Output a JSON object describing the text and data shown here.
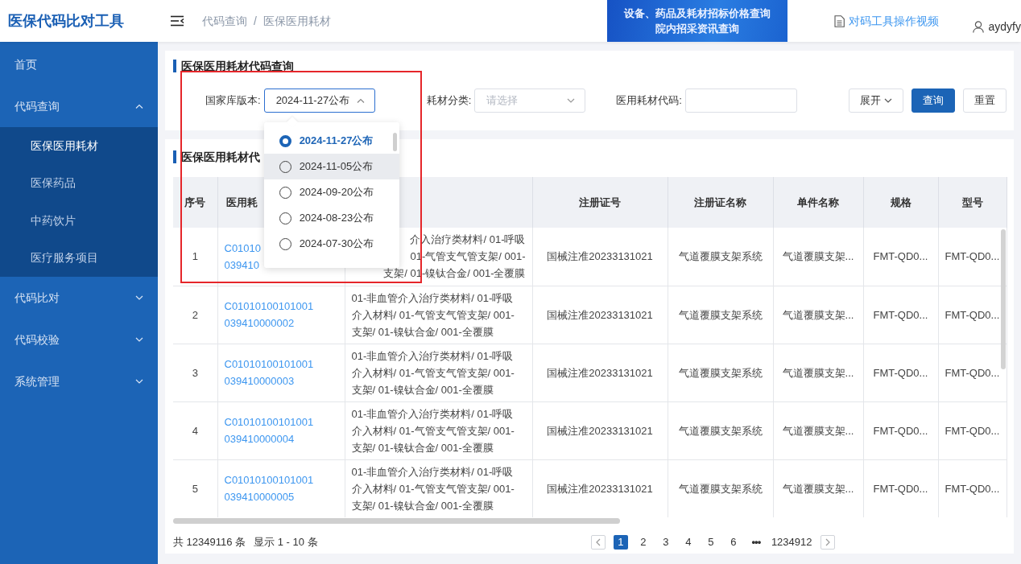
{
  "app": {
    "title": "医保代码比对工具"
  },
  "breadcrumb": {
    "items": [
      "代码查询",
      "医保医用耗材"
    ],
    "separator": "/"
  },
  "banner": {
    "lines": [
      "设备、药品及耗材**招标价格**查询",
      "院内招采**资讯**查询"
    ]
  },
  "header_link": "对码工具操作视频",
  "user": "aydyfy",
  "sidebar": {
    "items": [
      {
        "label": "首页",
        "kind": "link",
        "selected": false
      },
      {
        "label": "代码查询",
        "kind": "group",
        "selected": false,
        "expanded": true,
        "children": [
          {
            "label": "医保医用耗材",
            "selected": true
          },
          {
            "label": "医保药品",
            "selected": false
          },
          {
            "label": "中药饮片",
            "selected": false
          },
          {
            "label": "医疗服务项目",
            "selected": false
          }
        ]
      },
      {
        "label": "代码比对",
        "kind": "group",
        "selected": false,
        "expanded": false
      },
      {
        "label": "代码校验",
        "kind": "group",
        "selected": false,
        "expanded": false
      },
      {
        "label": "系统管理",
        "kind": "group",
        "selected": false,
        "expanded": false
      }
    ]
  },
  "search_panel": {
    "title": "医保医用耗材代码查询",
    "fields": [
      {
        "kind": "select",
        "label": "国家库版本:",
        "value": "2024-11-27公布",
        "open": true,
        "options": [
          {
            "label": "2024-11-27公布",
            "selected": true,
            "hovered": false
          },
          {
            "label": "2024-11-05公布",
            "selected": false,
            "hovered": true
          },
          {
            "label": "2024-09-20公布",
            "selected": false,
            "hovered": false
          },
          {
            "label": "2024-08-23公布",
            "selected": false,
            "hovered": false
          },
          {
            "label": "2024-07-30公布",
            "selected": false,
            "hovered": false
          }
        ]
      },
      {
        "kind": "select",
        "label": "耗材分类:",
        "placeholder": "请选择",
        "open": false
      },
      {
        "kind": "input",
        "label": "医用耗材代码:"
      }
    ],
    "buttons": [
      {
        "label": "展开",
        "kind": "toggle"
      },
      {
        "label": "查询",
        "kind": "primary"
      },
      {
        "label": "重置",
        "kind": "default"
      }
    ]
  },
  "results": {
    "title": "医保医用耗材代",
    "columns": [
      {
        "kind": "text",
        "label": "序号"
      },
      {
        "kind": "text",
        "label": "医用耗"
      },
      {
        "kind": "blank"
      },
      {
        "kind": "text",
        "label": "注册证号"
      },
      {
        "kind": "text",
        "label": "注册证名称"
      },
      {
        "kind": "text",
        "label": "单件名称"
      },
      {
        "kind": "text",
        "label": "规格"
      },
      {
        "kind": "text",
        "label": "型号"
      }
    ],
    "rows": [
      {
        "index": "1",
        "code": [
          "C01010",
          "039410"
        ],
        "category": [
          "介入治疗类材料/ 01-呼吸",
          "01-气管支气管支架/ 001-",
          "支架/ 01-镍钛合金/ 001-全覆膜"
        ],
        "covered": true,
        "reg_no": "国械注准20233131021",
        "reg_name": "气道覆膜支架系统",
        "item_name": "气道覆膜支架...",
        "spec": "FMT-QD0...",
        "model": "FMT-QD0..."
      },
      {
        "index": "2",
        "code": [
          "C01010100101001",
          "039410000002"
        ],
        "category": [
          "01-非血管介入治疗类材料/ 01-呼吸",
          "介入材料/ 01-气管支气管支架/ 001-",
          "支架/ 01-镍钛合金/ 001-全覆膜"
        ],
        "covered": false,
        "reg_no": "国械注准20233131021",
        "reg_name": "气道覆膜支架系统",
        "item_name": "气道覆膜支架...",
        "spec": "FMT-QD0...",
        "model": "FMT-QD0..."
      },
      {
        "index": "3",
        "code": [
          "C01010100101001",
          "039410000003"
        ],
        "category": [
          "01-非血管介入治疗类材料/ 01-呼吸",
          "介入材料/ 01-气管支气管支架/ 001-",
          "支架/ 01-镍钛合金/ 001-全覆膜"
        ],
        "covered": false,
        "reg_no": "国械注准20233131021",
        "reg_name": "气道覆膜支架系统",
        "item_name": "气道覆膜支架...",
        "spec": "FMT-QD0...",
        "model": "FMT-QD0..."
      },
      {
        "index": "4",
        "code": [
          "C01010100101001",
          "039410000004"
        ],
        "category": [
          "01-非血管介入治疗类材料/ 01-呼吸",
          "介入材料/ 01-气管支气管支架/ 001-",
          "支架/ 01-镍钛合金/ 001-全覆膜"
        ],
        "covered": false,
        "reg_no": "国械注准20233131021",
        "reg_name": "气道覆膜支架系统",
        "item_name": "气道覆膜支架...",
        "spec": "FMT-QD0...",
        "model": "FMT-QD0..."
      },
      {
        "index": "5",
        "code": [
          "C01010100101001",
          "039410000005"
        ],
        "category": [
          "01-非血管介入治疗类材料/ 01-呼吸",
          "介入材料/ 01-气管支气管支架/ 001-",
          "支架/ 01-镍钛合金/ 001-全覆膜"
        ],
        "covered": false,
        "reg_no": "国械注准20233131021",
        "reg_name": "气道覆膜支架系统",
        "item_name": "气道覆膜支架...",
        "spec": "FMT-QD0...",
        "model": "FMT-QD0..."
      }
    ]
  },
  "pagination": {
    "total": "共 12349116 条",
    "range": "显示 1 - 10 条",
    "pages": [
      {
        "label": "1",
        "kind": "page",
        "selected": true
      },
      {
        "label": "2",
        "kind": "page",
        "selected": false
      },
      {
        "label": "3",
        "kind": "page",
        "selected": false
      },
      {
        "label": "4",
        "kind": "page",
        "selected": false
      },
      {
        "label": "5",
        "kind": "page",
        "selected": false
      },
      {
        "label": "6",
        "kind": "page",
        "selected": false
      },
      {
        "label": "•••",
        "kind": "ellipsis",
        "selected": false
      },
      {
        "label": "1234912",
        "kind": "page",
        "selected": false
      }
    ]
  }
}
